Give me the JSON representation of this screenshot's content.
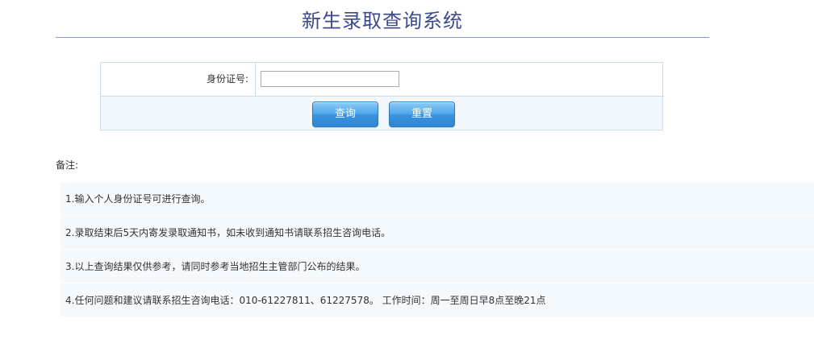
{
  "header": {
    "title": "新生录取查询系统"
  },
  "form": {
    "id_label": "身份证号:",
    "id_value": "",
    "id_placeholder": "",
    "query_label": "查询",
    "reset_label": "重置"
  },
  "notes": {
    "label": "备注:",
    "items": [
      "1.输入个人身份证号可进行查询。",
      "2.录取结束后5天内寄发录取通知书，如未收到通知书请联系招生咨询电话。",
      "3.以上查询结果仅供参考，请同时参考当地招生主管部门公布的结果。",
      "4.任何问题和建议请联系招生咨询电话：010-61227811、61227578。 工作时间：周一至周日早8点至晚21点"
    ]
  }
}
